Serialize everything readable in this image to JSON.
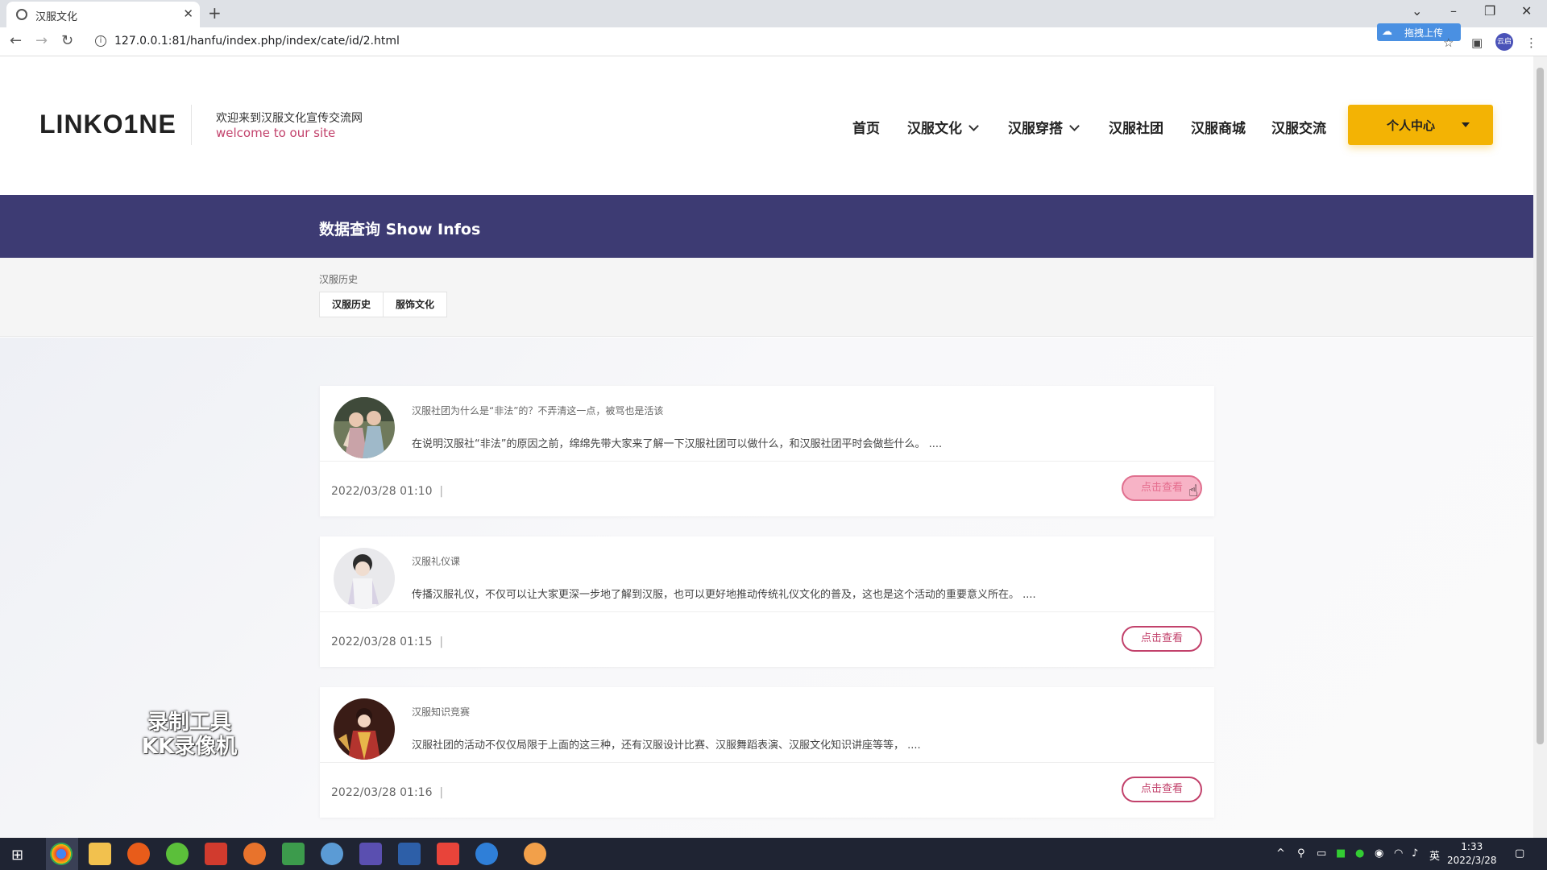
{
  "browser": {
    "tab_title": "汉服文化",
    "url": "127.0.0.1:81/hanfu/index.php/index/cate/id/2.html",
    "baidu_upload_label": "拖拽上传",
    "profile_label": "云启"
  },
  "header": {
    "logo": "LINKO1NE",
    "tagline_cn": "欢迎来到汉服文化宣传交流网",
    "tagline_en": "welcome to our site",
    "nav": [
      "首页",
      "汉服文化",
      "汉服穿搭",
      "汉服社团",
      "汉服商城",
      "汉服交流"
    ],
    "personal_center": "个人中心"
  },
  "banner": {
    "title": "数据查询 Show Infos"
  },
  "subnav": {
    "label": "汉服历史",
    "tabs": [
      "汉服历史",
      "服饰文化"
    ]
  },
  "cards": [
    {
      "title": "汉服社团为什么是“非法”的？不弄清这一点，被骂也是活该",
      "desc": "在说明汉服社“非法”的原因之前，绵绵先带大家来了解一下汉服社团可以做什么，和汉服社团平时会做些什么。 ....",
      "date": "2022/03/28 01:10",
      "sep": "|",
      "button": "点击查看"
    },
    {
      "title": "汉服礼仪课",
      "desc": "传播汉服礼仪，不仅可以让大家更深一步地了解到汉服，也可以更好地推动传统礼仪文化的普及，这也是这个活动的重要意义所在。 ....",
      "date": "2022/03/28 01:15",
      "sep": "|",
      "button": "点击查看"
    },
    {
      "title": "汉服知识竞赛",
      "desc": "汉服社团的活动不仅仅局限于上面的这三种，还有汉服设计比赛、汉服舞蹈表演、汉服文化知识讲座等等， ....",
      "date": "2022/03/28 01:16",
      "sep": "|",
      "button": "点击查看"
    }
  ],
  "watermark": {
    "line1": "录制工具",
    "line2": "KK录像机"
  },
  "taskbar": {
    "time": "1:33",
    "date": "2022/3/28",
    "ime": "英"
  },
  "colors": {
    "banner": "#3d3b73",
    "accent_pink": "#c2416b",
    "personal_btn": "#f3b304"
  }
}
